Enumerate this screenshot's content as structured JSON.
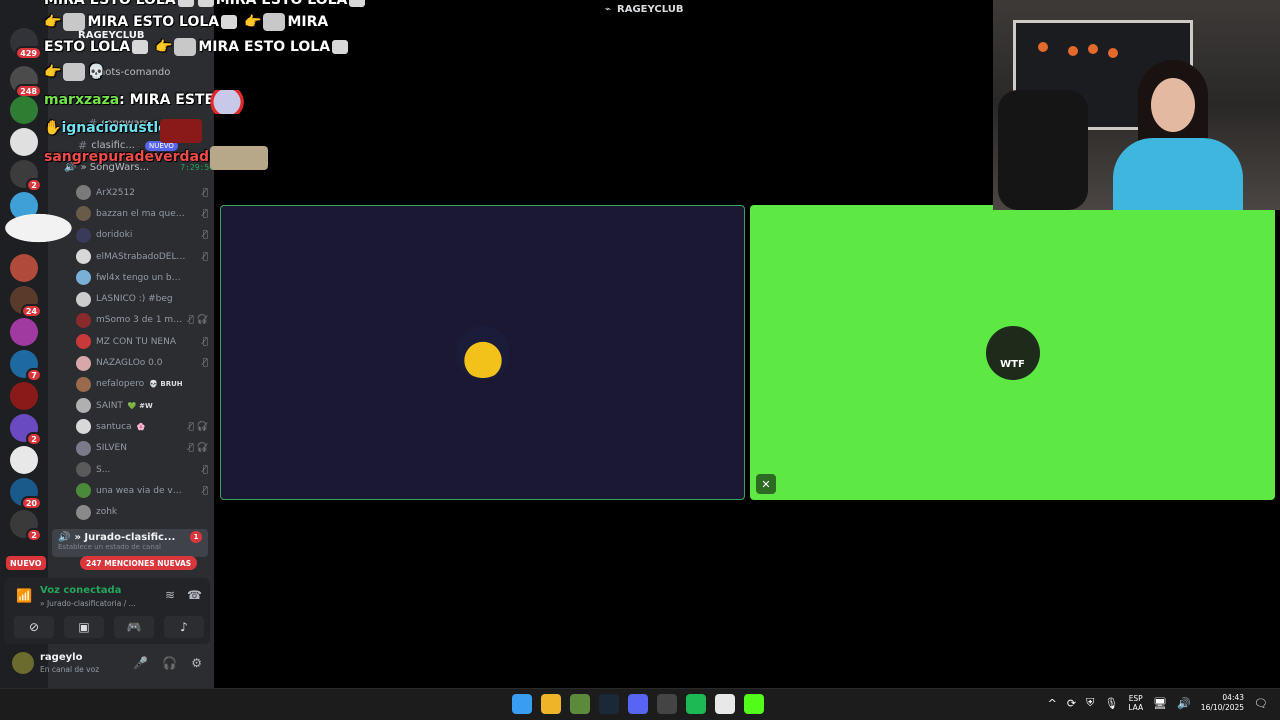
{
  "window": {
    "title": "RAGEYCLUB"
  },
  "rail": {
    "servers": [
      {
        "icon": "discord-icon",
        "badge": "429",
        "color": "#313338"
      },
      {
        "icon": "server-icon",
        "badge": "248",
        "color": "#4b4b4b"
      },
      {
        "icon": "server-icon",
        "badge": "",
        "color": "#2e7d32"
      },
      {
        "icon": "server-icon",
        "badge": "",
        "color": "#e0e0e0"
      },
      {
        "icon": "server-icon",
        "badge": "2",
        "color": "#3c3c3c"
      },
      {
        "icon": "server-icon",
        "badge": "",
        "color": "#3fa0d8"
      },
      {
        "icon": "server-icon",
        "badge": "",
        "color": "#b04a3a"
      },
      {
        "icon": "server-icon",
        "badge": "24",
        "color": "#5a3a2a"
      },
      {
        "icon": "server-icon",
        "badge": "",
        "color": "#a03aa0"
      },
      {
        "icon": "server-icon",
        "badge": "7",
        "color": "#1e6aa0"
      },
      {
        "icon": "server-icon",
        "badge": "",
        "color": "#8a1a1a"
      },
      {
        "icon": "server-icon",
        "badge": "2",
        "color": "#6a4ac0"
      },
      {
        "icon": "server-icon",
        "badge": "",
        "color": "#e8e8e8"
      },
      {
        "icon": "server-icon",
        "badge": "20",
        "color": "#1a5a8a"
      },
      {
        "icon": "server-icon",
        "badge": "2",
        "color": "#3a3a3a"
      }
    ],
    "new_label": "NUEVO"
  },
  "sidebar": {
    "server_name": "RAGEYCLUB",
    "channels": [
      {
        "name": "mots-comando",
        "new": ""
      },
      {
        "name": "songwars",
        "new": ""
      },
      {
        "name": "clasific...",
        "new": "NUEVO"
      }
    ],
    "voice_channel": {
      "name": "» SongWars...",
      "time": "7:29:56"
    },
    "members": [
      {
        "name": "ArX2512",
        "tag": "",
        "color": "#7a7a7a",
        "icons": "🎙̸"
      },
      {
        "name": "bazzan el ma que tose",
        "tag": "",
        "color": "#6a5a4a",
        "icons": "🎙̸"
      },
      {
        "name": "doridoki",
        "tag": "",
        "color": "#3a3a5a",
        "icons": "🎙̸"
      },
      {
        "name": "elMAStrabadoDELu...",
        "tag": "",
        "color": "#d8d8d8",
        "icons": "🎙̸"
      },
      {
        "name": "fwl4x tengo un banger xd",
        "tag": "",
        "color": "#7ab0d8",
        "icons": ""
      },
      {
        "name": "LÁSNICO :) #beg",
        "tag": "",
        "color": "#cccccc",
        "icons": ""
      },
      {
        "name": "mSomo 3 de 1 mi...",
        "tag": "",
        "color": "#8a2a2a",
        "icons": "🎙̸ 🎧̸"
      },
      {
        "name": "MZ CON TU NENA",
        "tag": "",
        "color": "#c83a3a",
        "icons": "🎙̸"
      },
      {
        "name": "NAZAGLOo 0.0",
        "tag": "",
        "color": "#d8a8a8",
        "icons": "🎙̸"
      },
      {
        "name": "nefalopero",
        "tag": "💀 BRUH",
        "color": "#9a6a4a",
        "icons": ""
      },
      {
        "name": "SAINT",
        "tag": "💚 #W",
        "color": "#b0b0b0",
        "icons": ""
      },
      {
        "name": "santuca",
        "tag": "🌸",
        "color": "#d8d8d8",
        "icons": "🎙̸ 🎧̸"
      },
      {
        "name": "SILVEN",
        "tag": "",
        "color": "#7a7a8a",
        "icons": "🎙̸ 🎧̸"
      },
      {
        "name": "S...",
        "tag": "",
        "color": "#5a5a5a",
        "icons": "🎙̸"
      },
      {
        "name": "una wea via de verd...",
        "tag": "",
        "color": "#4a8a3a",
        "icons": "🎙̸"
      },
      {
        "name": "zohk",
        "tag": "",
        "color": "#8a8a8a",
        "icons": ""
      }
    ],
    "jurado": {
      "name": "» Jurado-clasific...",
      "sub": "Establece un estado de canal",
      "badge": "1",
      "peek": "nigu"
    },
    "mentions_label": "247 MENCIONES NUEVAS"
  },
  "voice_panel": {
    "status": "Voz conectada",
    "channel": "» Jurado-clasificatoria / ..."
  },
  "user_panel": {
    "username": "rageylo",
    "status": "En canal de voz"
  },
  "stage": {
    "tiles": [
      {
        "bg": "#1a1832",
        "avatar": "emo-avatar"
      },
      {
        "bg": "#5ee843",
        "avatar": "wtf-logo",
        "logo_text": "WTF"
      }
    ]
  },
  "chat": {
    "lines": [
      {
        "text": "MIRA ESTO LOLA"
      },
      {
        "text": "MIRA ESTO LOLA"
      },
      {
        "text": "MIRA"
      },
      {
        "text": "ESTO LOLA"
      },
      {
        "text": "MIRA ESTO LOLA"
      }
    ],
    "messages": [
      {
        "user": "marxzaza",
        "text": "MIRA ESTE",
        "color": "#74e34a"
      },
      {
        "user": "ignacionustle",
        "text": "",
        "color": "#6fe0f0"
      },
      {
        "user": "sangrepuradeverdad",
        "text": "",
        "color": "#f14b4b"
      }
    ]
  },
  "taskbar": {
    "apps": [
      {
        "icon": "windows-start-icon",
        "color": "#3a9ef0"
      },
      {
        "icon": "file-explorer-icon",
        "color": "#f0b429"
      },
      {
        "icon": "minecraft-icon",
        "color": "#5a8a3a"
      },
      {
        "icon": "steam-icon",
        "color": "#1b2838"
      },
      {
        "icon": "discord-icon",
        "color": "#5865f2"
      },
      {
        "icon": "settings-icon",
        "color": "#444444"
      },
      {
        "icon": "spotify-icon",
        "color": "#1db954"
      },
      {
        "icon": "chrome-icon",
        "color": "#e8e8e8"
      },
      {
        "icon": "kick-icon",
        "color": "#53fc18"
      }
    ],
    "lang_top": "ESP",
    "lang_bottom": "LAA",
    "time": "04:43",
    "date": "16/10/2025"
  }
}
